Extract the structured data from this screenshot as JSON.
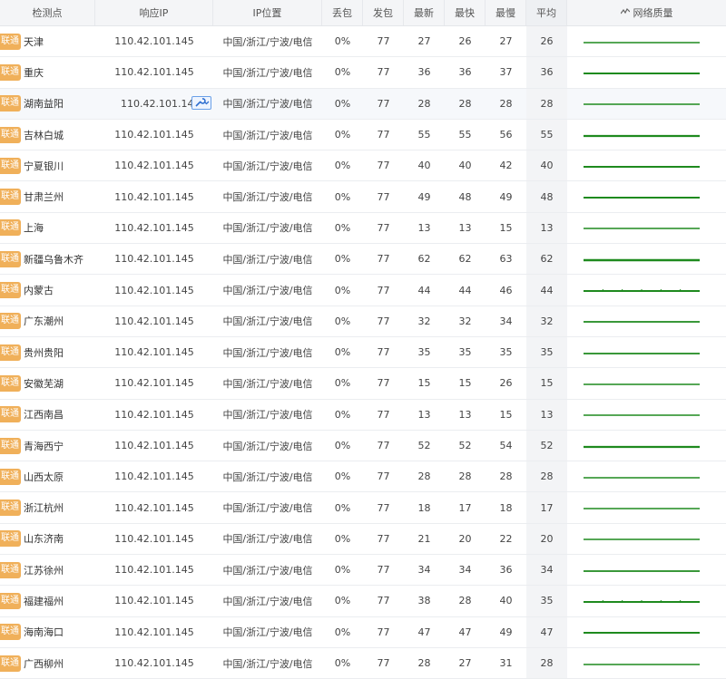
{
  "header": {
    "node": "检测点",
    "ip": "响应IP",
    "location": "IP位置",
    "loss": "丢包",
    "sent": "发包",
    "latest": "最新",
    "fastest": "最快",
    "slowest": "最慢",
    "average": "平均",
    "quality": "网络质量",
    "quality_icon": "trend-icon"
  },
  "colors": {
    "isp_badge": "#f0b05a",
    "quality_line": "#1e8a1e"
  },
  "rows": [
    {
      "isp": "联通",
      "node": "天津",
      "ip": "110.42.101.145",
      "loc": "中国/浙江/宁波/电信",
      "loss": "0%",
      "sent": "77",
      "latest": "27",
      "fastest": "26",
      "slowest": "27",
      "avg": "26",
      "quality": 0.2
    },
    {
      "isp": "联通",
      "node": "重庆",
      "ip": "110.42.101.145",
      "loc": "中国/浙江/宁波/电信",
      "loss": "0%",
      "sent": "77",
      "latest": "36",
      "fastest": "36",
      "slowest": "37",
      "avg": "36",
      "quality": 0.4
    },
    {
      "isp": "联通",
      "node": "湖南益阳",
      "ip": "110.42.101.145",
      "loc": "中国/浙江/宁波/电信",
      "loss": "0%",
      "sent": "77",
      "latest": "28",
      "fastest": "28",
      "slowest": "28",
      "avg": "28",
      "quality": 0.2,
      "highlight": true
    },
    {
      "isp": "联通",
      "node": "吉林白城",
      "ip": "110.42.101.145",
      "loc": "中国/浙江/宁波/电信",
      "loss": "0%",
      "sent": "77",
      "latest": "55",
      "fastest": "55",
      "slowest": "56",
      "avg": "55",
      "quality": 0.6
    },
    {
      "isp": "联通",
      "node": "宁夏银川",
      "ip": "110.42.101.145",
      "loc": "中国/浙江/宁波/电信",
      "loss": "0%",
      "sent": "77",
      "latest": "40",
      "fastest": "40",
      "slowest": "42",
      "avg": "40",
      "quality": 0.4
    },
    {
      "isp": "联通",
      "node": "甘肃兰州",
      "ip": "110.42.101.145",
      "loc": "中国/浙江/宁波/电信",
      "loss": "0%",
      "sent": "77",
      "latest": "49",
      "fastest": "48",
      "slowest": "49",
      "avg": "48",
      "quality": 0.5
    },
    {
      "isp": "联通",
      "node": "上海",
      "ip": "110.42.101.145",
      "loc": "中国/浙江/宁波/电信",
      "loss": "0%",
      "sent": "77",
      "latest": "13",
      "fastest": "13",
      "slowest": "15",
      "avg": "13",
      "quality": 0.2
    },
    {
      "isp": "联通",
      "node": "新疆乌鲁木齐",
      "ip": "110.42.101.145",
      "loc": "中国/浙江/宁波/电信",
      "loss": "0%",
      "sent": "77",
      "latest": "62",
      "fastest": "62",
      "slowest": "63",
      "avg": "62",
      "quality": 0.7
    },
    {
      "isp": "联通",
      "node": "内蒙古",
      "ip": "110.42.101.145",
      "loc": "中国/浙江/宁波/电信",
      "loss": "0%",
      "sent": "77",
      "latest": "44",
      "fastest": "44",
      "slowest": "46",
      "avg": "44",
      "quality": 0.4,
      "jitter": true
    },
    {
      "isp": "联通",
      "node": "广东潮州",
      "ip": "110.42.101.145",
      "loc": "中国/浙江/宁波/电信",
      "loss": "0%",
      "sent": "77",
      "latest": "32",
      "fastest": "32",
      "slowest": "34",
      "avg": "32",
      "quality": 0.3
    },
    {
      "isp": "联通",
      "node": "贵州贵阳",
      "ip": "110.42.101.145",
      "loc": "中国/浙江/宁波/电信",
      "loss": "0%",
      "sent": "77",
      "latest": "35",
      "fastest": "35",
      "slowest": "35",
      "avg": "35",
      "quality": 0.3
    },
    {
      "isp": "联通",
      "node": "安徽芜湖",
      "ip": "110.42.101.145",
      "loc": "中国/浙江/宁波/电信",
      "loss": "0%",
      "sent": "77",
      "latest": "15",
      "fastest": "15",
      "slowest": "26",
      "avg": "15",
      "quality": 0.2
    },
    {
      "isp": "联通",
      "node": "江西南昌",
      "ip": "110.42.101.145",
      "loc": "中国/浙江/宁波/电信",
      "loss": "0%",
      "sent": "77",
      "latest": "13",
      "fastest": "13",
      "slowest": "15",
      "avg": "13",
      "quality": 0.2
    },
    {
      "isp": "联通",
      "node": "青海西宁",
      "ip": "110.42.101.145",
      "loc": "中国/浙江/宁波/电信",
      "loss": "0%",
      "sent": "77",
      "latest": "52",
      "fastest": "52",
      "slowest": "54",
      "avg": "52",
      "quality": 0.6
    },
    {
      "isp": "联通",
      "node": "山西太原",
      "ip": "110.42.101.145",
      "loc": "中国/浙江/宁波/电信",
      "loss": "0%",
      "sent": "77",
      "latest": "28",
      "fastest": "28",
      "slowest": "28",
      "avg": "28",
      "quality": 0.2
    },
    {
      "isp": "联通",
      "node": "浙江杭州",
      "ip": "110.42.101.145",
      "loc": "中国/浙江/宁波/电信",
      "loss": "0%",
      "sent": "77",
      "latest": "18",
      "fastest": "17",
      "slowest": "18",
      "avg": "17",
      "quality": 0.2
    },
    {
      "isp": "联通",
      "node": "山东济南",
      "ip": "110.42.101.145",
      "loc": "中国/浙江/宁波/电信",
      "loss": "0%",
      "sent": "77",
      "latest": "21",
      "fastest": "20",
      "slowest": "22",
      "avg": "20",
      "quality": 0.2
    },
    {
      "isp": "联通",
      "node": "江苏徐州",
      "ip": "110.42.101.145",
      "loc": "中国/浙江/宁波/电信",
      "loss": "0%",
      "sent": "77",
      "latest": "34",
      "fastest": "34",
      "slowest": "36",
      "avg": "34",
      "quality": 0.3
    },
    {
      "isp": "联通",
      "node": "福建福州",
      "ip": "110.42.101.145",
      "loc": "中国/浙江/宁波/电信",
      "loss": "0%",
      "sent": "77",
      "latest": "38",
      "fastest": "28",
      "slowest": "40",
      "avg": "35",
      "quality": 0.4,
      "jitter": true
    },
    {
      "isp": "联通",
      "node": "海南海口",
      "ip": "110.42.101.145",
      "loc": "中国/浙江/宁波/电信",
      "loss": "0%",
      "sent": "77",
      "latest": "47",
      "fastest": "47",
      "slowest": "49",
      "avg": "47",
      "quality": 0.5
    },
    {
      "isp": "联通",
      "node": "广西柳州",
      "ip": "110.42.101.145",
      "loc": "中国/浙江/宁波/电信",
      "loss": "0%",
      "sent": "77",
      "latest": "28",
      "fastest": "27",
      "slowest": "31",
      "avg": "28",
      "quality": 0.2
    }
  ]
}
